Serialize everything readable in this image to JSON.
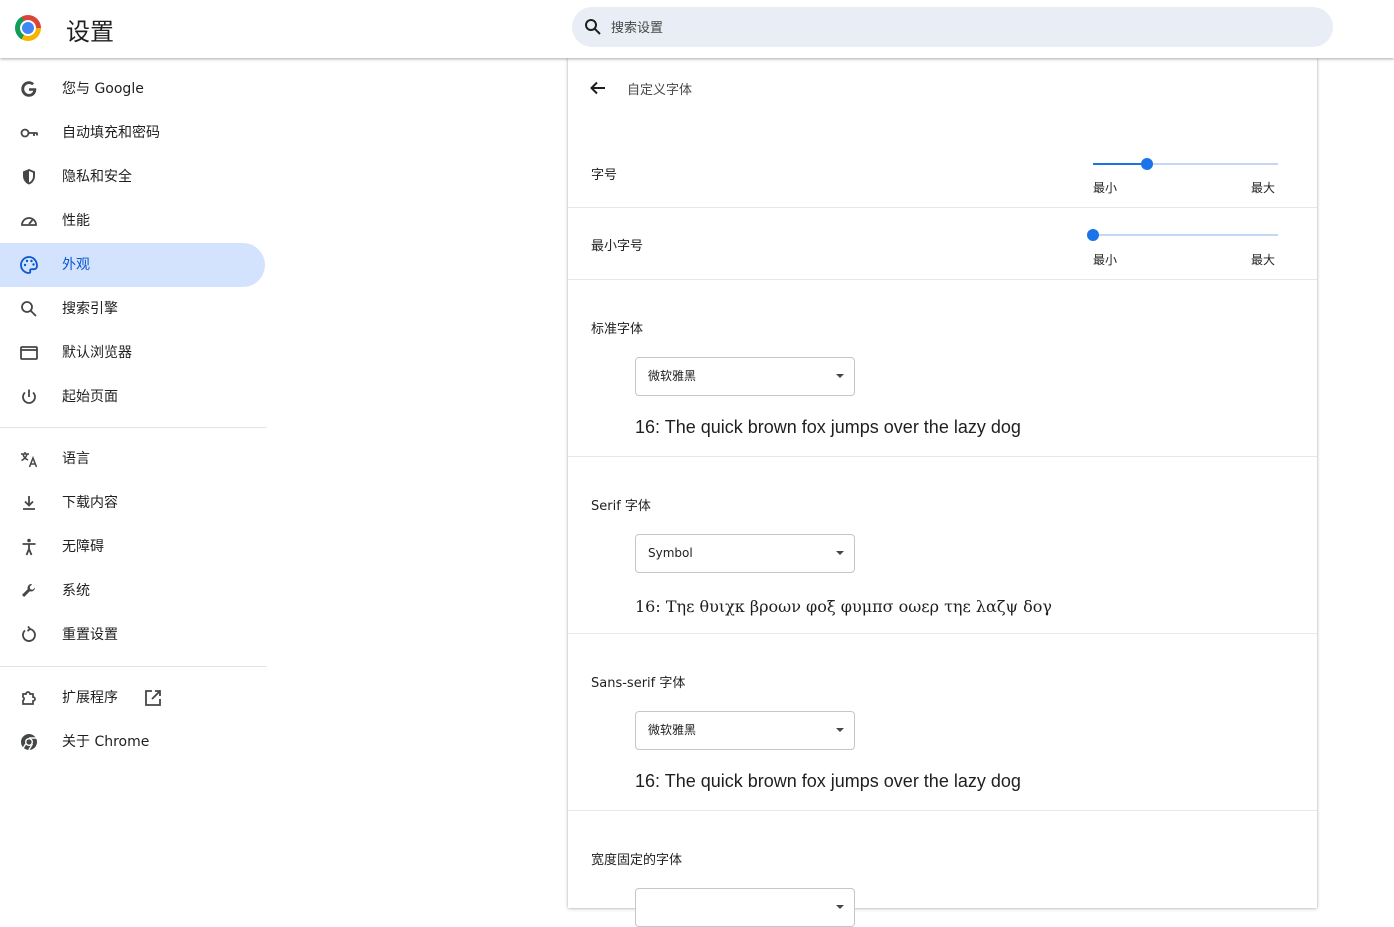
{
  "header": {
    "title": "设置",
    "search_placeholder": "搜索设置"
  },
  "sidebar": {
    "items": [
      {
        "label": "您与 Google",
        "icon": "google-icon"
      },
      {
        "label": "自动填充和密码",
        "icon": "key-icon"
      },
      {
        "label": "隐私和安全",
        "icon": "shield-icon"
      },
      {
        "label": "性能",
        "icon": "speedometer-icon"
      },
      {
        "label": "外观",
        "icon": "palette-icon",
        "active": true
      },
      {
        "label": "搜索引擎",
        "icon": "search-icon"
      },
      {
        "label": "默认浏览器",
        "icon": "browser-window-icon"
      },
      {
        "label": "起始页面",
        "icon": "power-icon"
      },
      {
        "label": "语言",
        "icon": "translate-icon"
      },
      {
        "label": "下载内容",
        "icon": "download-icon"
      },
      {
        "label": "无障碍",
        "icon": "accessibility-icon"
      },
      {
        "label": "系统",
        "icon": "wrench-icon"
      },
      {
        "label": "重置设置",
        "icon": "reset-icon"
      },
      {
        "label": "扩展程序",
        "icon": "puzzle-icon"
      },
      {
        "label": "关于 Chrome",
        "icon": "chrome-icon"
      }
    ],
    "external_link_icon": "external-link-icon"
  },
  "main": {
    "page_title": "自定义字体",
    "font_size": {
      "label": "字号",
      "min_label": "最小",
      "max_label": "最大",
      "level": 0.29
    },
    "min_font_size": {
      "label": "最小字号",
      "min_label": "最小",
      "max_label": "最大",
      "level": 0.0
    },
    "standard_font": {
      "label": "标准字体",
      "value": "微软雅黑",
      "sample": "16: The quick brown fox jumps over the lazy dog"
    },
    "serif_font": {
      "label": "Serif 字体",
      "value": "Symbol",
      "sample": "16: Τηε θυιχκ βροων φοξ φυμπσ οωερ τηε λαζψ δογ"
    },
    "sans_serif_font": {
      "label": "Sans-serif 字体",
      "value": "微软雅黑",
      "sample": "16: The quick brown fox jumps over the lazy dog"
    },
    "fixed_width_font": {
      "label": "宽度固定的字体"
    }
  },
  "colors": {
    "accent": "#1a73e8",
    "active_nav_bg": "#d3e3fd",
    "search_bg": "#e9eef6"
  }
}
